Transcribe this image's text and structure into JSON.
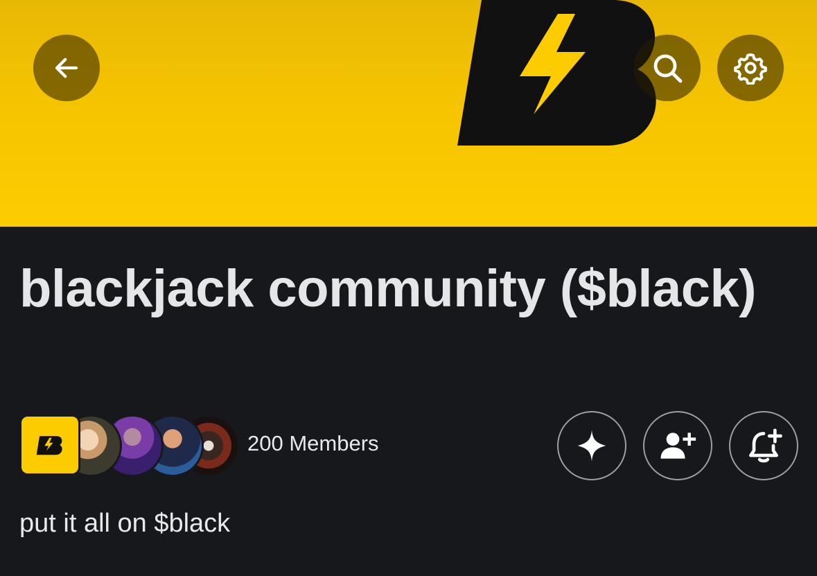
{
  "header": {
    "back_icon": "arrow-left-icon",
    "search_icon": "search-icon",
    "settings_icon": "gear-icon"
  },
  "community": {
    "title": "blackjack community ($black)",
    "members_label": "200 Members",
    "bio": "put it all on $black",
    "brand_color": "#fdcc00"
  },
  "actions": [
    {
      "icon": "sparkle-icon"
    },
    {
      "icon": "add-user-icon"
    },
    {
      "icon": "bell-plus-icon"
    }
  ]
}
